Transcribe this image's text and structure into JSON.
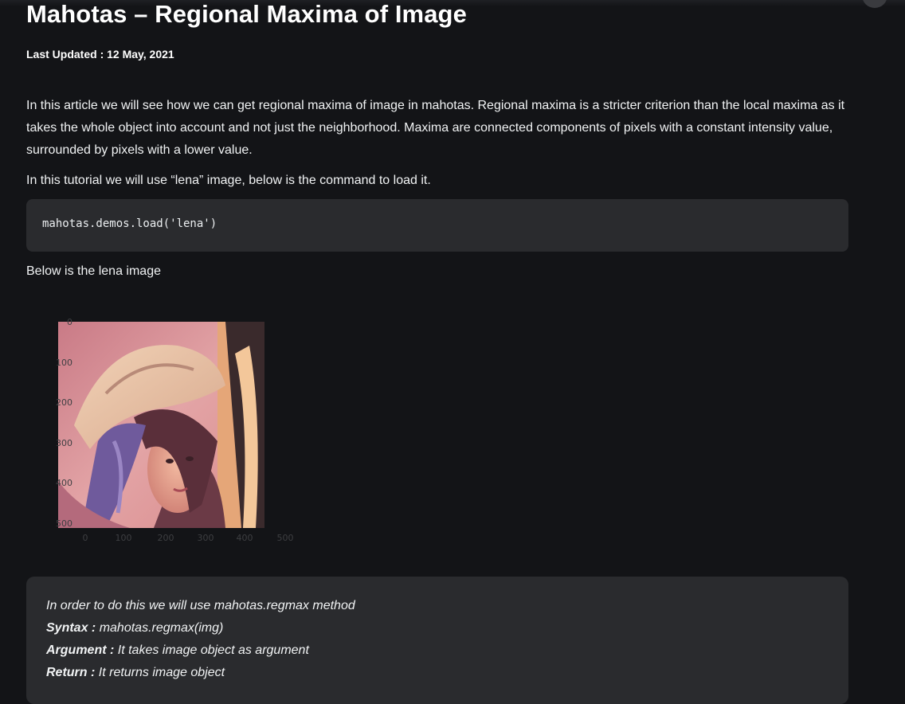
{
  "article": {
    "title": "Mahotas – Regional Maxima of Image",
    "last_updated": "Last Updated : 12 May, 2021",
    "intro_paragraph": "In this article we will see how we can get regional maxima of image in mahotas. Regional maxima is a stricter criterion than the local maxima as it takes the whole object into account and not just the neighborhood. Maxima are connected components of pixels with a constant intensity value, surrounded by pixels with a lower value.",
    "tutorial_line": "In this tutorial we will use “lena” image, below is the command to load it.",
    "code": "mahotas.demos.load('lena')",
    "below_text": "Below is the lena image"
  },
  "figure": {
    "y_ticks": [
      "0",
      "100",
      "200",
      "300",
      "400",
      "500"
    ],
    "x_ticks": [
      "0",
      "100",
      "200",
      "300",
      "400",
      "500"
    ]
  },
  "note": {
    "line1": "In order to do this we will use mahotas.regmax method",
    "syntax_label": "Syntax :",
    "syntax_value": " mahotas.regmax(img)",
    "argument_label": "Argument :",
    "argument_value": " It takes image object as argument",
    "return_label": "Return :",
    "return_value": " It returns image object"
  },
  "colors": {
    "background": "#131417",
    "code_bg": "#2a2b2e",
    "text": "#f1f3f4"
  }
}
